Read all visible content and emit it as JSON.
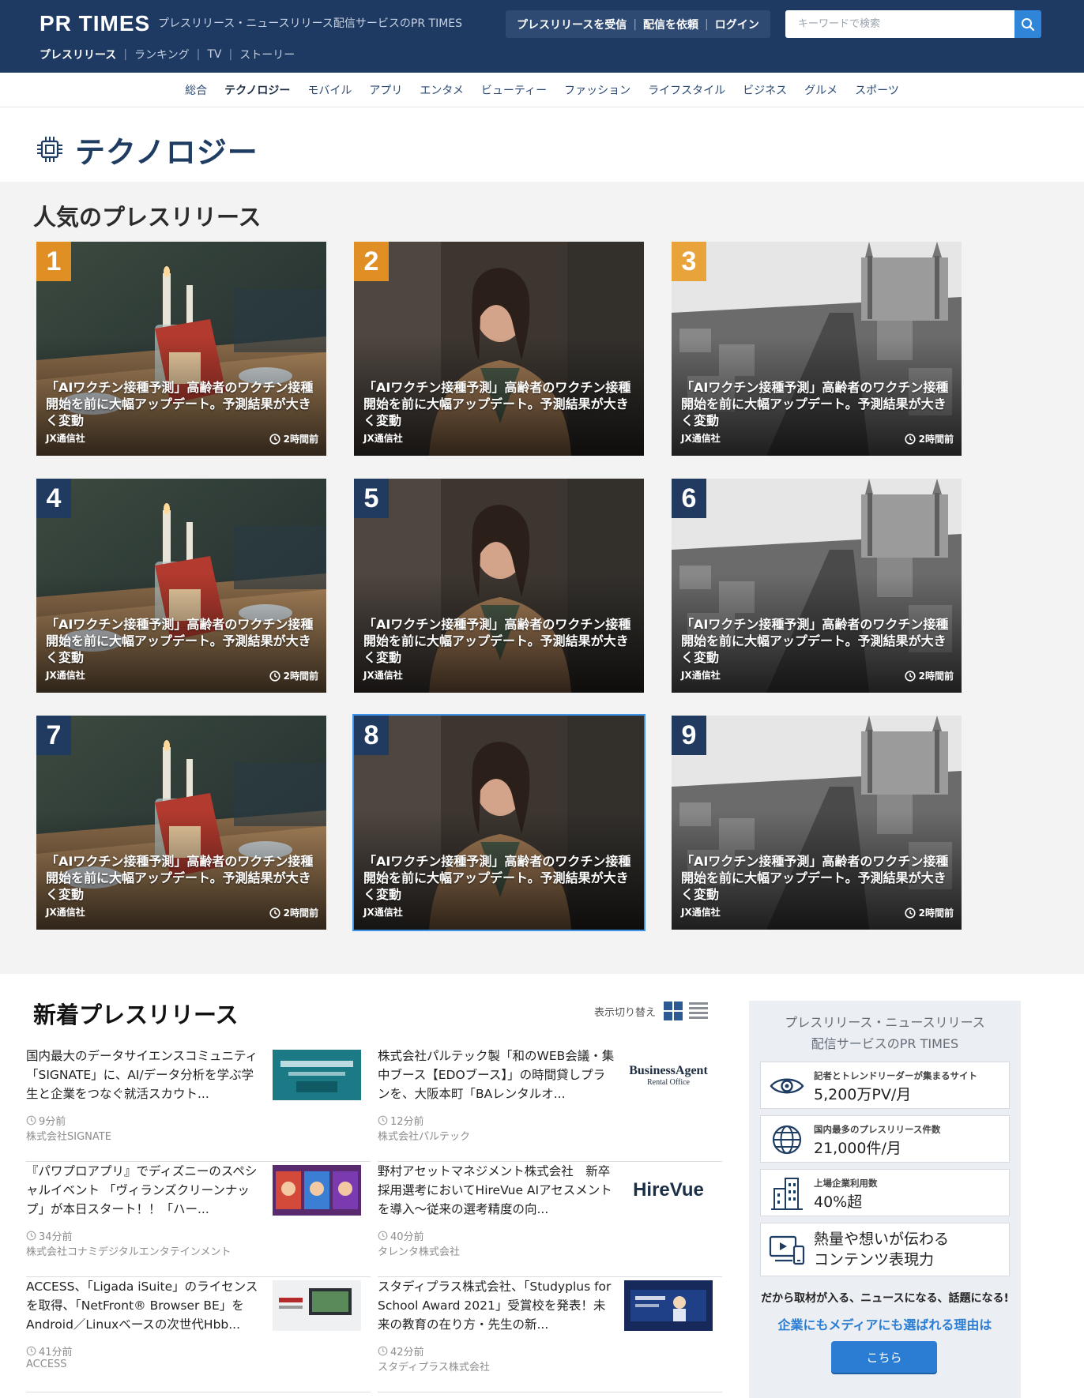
{
  "header": {
    "logo": "PR TIMES",
    "tagline": "プレスリリース・ニュースリリース配信サービスのPR TIMES",
    "subnav": [
      "プレスリリース",
      "ランキング",
      "TV",
      "ストーリー"
    ],
    "actions": [
      "プレスリリースを受信",
      "配信を依頼",
      "ログイン"
    ],
    "search_placeholder": "キーワードで検索"
  },
  "categories": [
    "総合",
    "テクノロジー",
    "モバイル",
    "アプリ",
    "エンタメ",
    "ビューティー",
    "ファッション",
    "ライフスタイル",
    "ビジネス",
    "グルメ",
    "スポーツ"
  ],
  "active_category": "テクノロジー",
  "page_title": "テクノロジー",
  "popular": {
    "title": "人気のプレスリリース",
    "items": [
      {
        "rank": "1",
        "title": "「AIワクチン接種予測」高齢者のワクチン接種開始を前に大幅アップデート。予測結果が大きく変動",
        "company": "JX通信社",
        "time": "2時間前",
        "image": "table",
        "rank_color": "#e08f24"
      },
      {
        "rank": "2",
        "title": "「AIワクチン接種予測」高齢者のワクチン接種開始を前に大幅アップデート。予測結果が大きく変動",
        "company": "JX通信社",
        "time": "",
        "image": "woman",
        "rank_color": "#e08f24"
      },
      {
        "rank": "3",
        "title": "「AIワクチン接種予測」高齢者のワクチン接種開始を前に大幅アップデート。予測結果が大きく変動",
        "company": "JX通信社",
        "time": "2時間前",
        "image": "city",
        "rank_color": "#e9a33b"
      },
      {
        "rank": "4",
        "title": "「AIワクチン接種予測」高齢者のワクチン接種開始を前に大幅アップデート。予測結果が大きく変動",
        "company": "JX通信社",
        "time": "2時間前",
        "image": "table",
        "rank_color": "#213a60"
      },
      {
        "rank": "5",
        "title": "「AIワクチン接種予測」高齢者のワクチン接種開始を前に大幅アップデート。予測結果が大きく変動",
        "company": "JX通信社",
        "time": "",
        "image": "woman",
        "rank_color": "#213a60"
      },
      {
        "rank": "6",
        "title": "「AIワクチン接種予測」高齢者のワクチン接種開始を前に大幅アップデート。予測結果が大きく変動",
        "company": "JX通信社",
        "time": "2時間前",
        "image": "city",
        "rank_color": "#213a60"
      },
      {
        "rank": "7",
        "title": "「AIワクチン接種予測」高齢者のワクチン接種開始を前に大幅アップデート。予測結果が大きく変動",
        "company": "JX通信社",
        "time": "2時間前",
        "image": "table",
        "rank_color": "#213a60"
      },
      {
        "rank": "8",
        "title": "「AIワクチン接種予測」高齢者のワクチン接種開始を前に大幅アップデート。予測結果が大きく変動",
        "company": "JX通信社",
        "time": "",
        "image": "woman",
        "rank_color": "#213a60"
      },
      {
        "rank": "9",
        "title": "「AIワクチン接種予測」高齢者のワクチン接種開始を前に大幅アップデート。予測結果が大きく変動",
        "company": "JX通信社",
        "time": "2時間前",
        "image": "city",
        "rank_color": "#213a60"
      }
    ]
  },
  "new_releases": {
    "title": "新着プレスリリース",
    "view_toggle_label": "表示切り替え",
    "items": [
      {
        "title": "国内最大のデータサイエンスコミュニティ「SIGNATE」に、AI/データ分析を学ぶ学生と企業をつなぐ就活スカウト...",
        "time": "9分前",
        "company": "株式会社SIGNATE",
        "thumb": "signate"
      },
      {
        "title": "株式会社パルテック製「和のWEB会議・集中ブース【EDOブース】」の時間貸しプランを、大阪本町「BAレンタルオ...",
        "time": "12分前",
        "company": "株式会社パルテック",
        "thumb": "businessagent",
        "thumb_text": "BusinessAgent",
        "thumb_sub": "Rental Office"
      },
      {
        "title": "『パワプロアプリ』でディズニーのスペシャルイベント 「ヴィランズクリーンナップ」が本日スタート！！「ハー...",
        "time": "34分前",
        "company": "株式会社コナミデジタルエンタテインメント",
        "thumb": "powapro"
      },
      {
        "title": "野村アセットマネジメント株式会社　新卒採用選考においてHireVue AIアセスメントを導入〜従来の選考精度の向...",
        "time": "40分前",
        "company": "タレンタ株式会社",
        "thumb": "hirevue",
        "thumb_text": "HireVue"
      },
      {
        "title": "ACCESS、「Ligada iSuite」のライセンスを取得、「NetFront® Browser BE」をAndroid／Linuxベースの次世代Hbb...",
        "time": "41分前",
        "company": "ACCESS",
        "thumb": "access"
      },
      {
        "title": "スタディプラス株式会社、「Studyplus for School Award 2021」受賞校を発表！未来の教育の在り方・先生の新...",
        "time": "42分前",
        "company": "スタディプラス株式会社",
        "thumb": "studyplus"
      }
    ]
  },
  "side": {
    "title_line1": "プレスリリース・ニュースリリース",
    "title_line2": "配信サービスのPR TIMES",
    "features": [
      {
        "small": "記者とトレンドリーダーが集まるサイト",
        "big": "5,200万PV/月",
        "icon": "eye-icon"
      },
      {
        "small": "国内最多のプレスリリース件数",
        "big": "21,000件/月",
        "icon": "globe-icon"
      },
      {
        "small": "上場企業利用数",
        "big": "40%超",
        "icon": "building-icon"
      },
      {
        "small": "",
        "big_line1": "熱量や想いが伝わる",
        "big_line2": "コンテンツ表現力",
        "icon": "devices-icon"
      }
    ],
    "tagline1": "だから取材が入る、ニュースになる、話題になる!",
    "tagline2": "企業にもメディアにも選ばれる理由は",
    "cta": "こちら"
  },
  "colors": {
    "header_bg": "#1e3a62",
    "accent_blue": "#2a7dd3",
    "rank_gold": "#e08f24",
    "rank_navy": "#213a60"
  }
}
